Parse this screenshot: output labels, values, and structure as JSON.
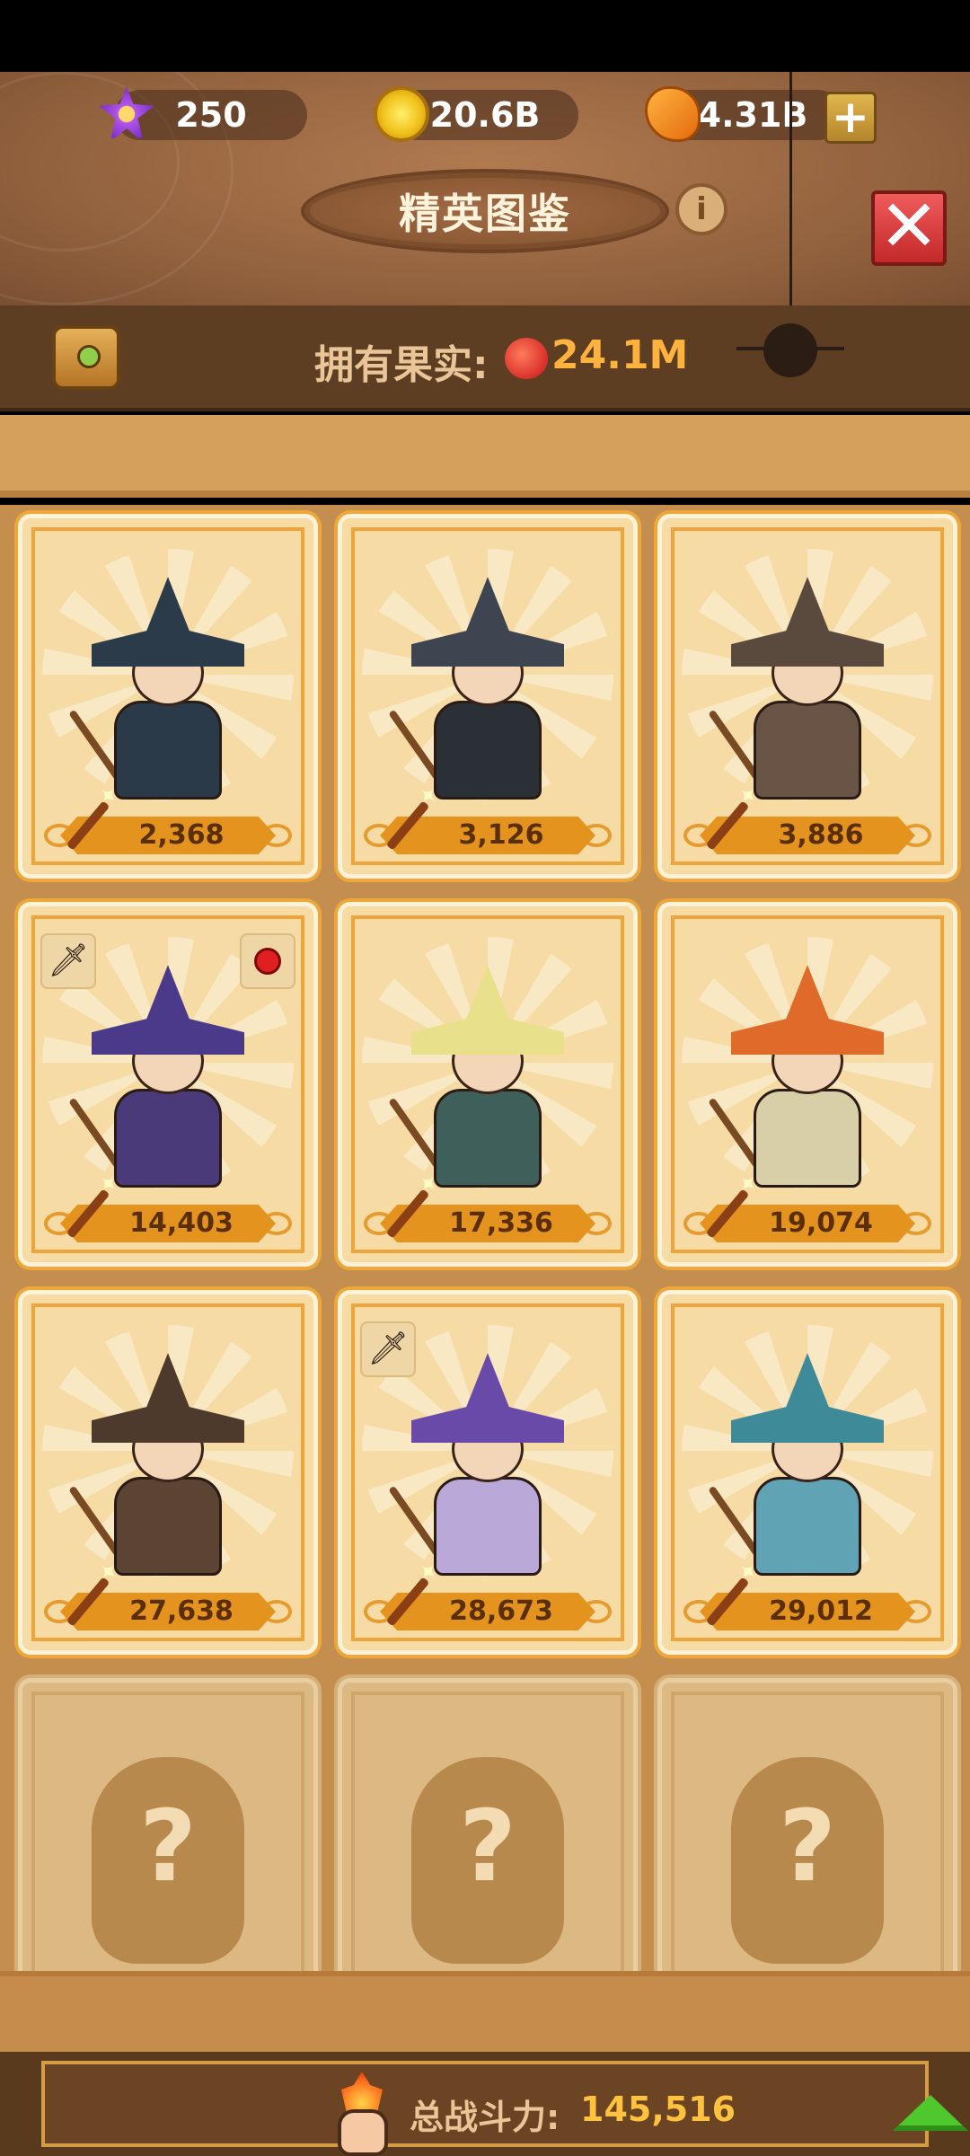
{
  "header": {
    "resources": [
      {
        "name": "gem",
        "value": "250"
      },
      {
        "name": "coin",
        "value": "20.6B"
      },
      {
        "name": "amber",
        "value": "4.31B"
      }
    ],
    "title": "精英图鉴",
    "close_label": "✕",
    "plus_label": "+",
    "info_label": "i"
  },
  "fruit": {
    "label": "拥有果实:",
    "value": "24.1M"
  },
  "cards": [
    {
      "power": "2,368",
      "hat_color": "#2c3b4a",
      "robe_color": "#2a3a48"
    },
    {
      "power": "3,126",
      "hat_color": "#3e4450",
      "robe_color": "#2b2f36"
    },
    {
      "power": "3,886",
      "hat_color": "#5a4a3e",
      "robe_color": "#6a5446"
    },
    {
      "power": "14,403",
      "hat_color": "#4b3a8a",
      "robe_color": "#4a3a7a"
    },
    {
      "power": "17,336",
      "hat_color": "#e8e08a",
      "robe_color": "#3f5f5a"
    },
    {
      "power": "19,074",
      "hat_color": "#e06a2a",
      "robe_color": "#d8cfa8"
    },
    {
      "power": "27,638",
      "hat_color": "#4e3a2c",
      "robe_color": "#5b4434"
    },
    {
      "power": "28,673",
      "hat_color": "#6a4aa8",
      "robe_color": "#b9a8d8"
    },
    {
      "power": "29,012",
      "hat_color": "#3f8a98",
      "robe_color": "#5fa3b5"
    }
  ],
  "locked": [
    {
      "label": "?"
    },
    {
      "label": "?"
    },
    {
      "label": "?"
    }
  ],
  "power": {
    "label": "总战斗力:",
    "value": "145,516"
  }
}
